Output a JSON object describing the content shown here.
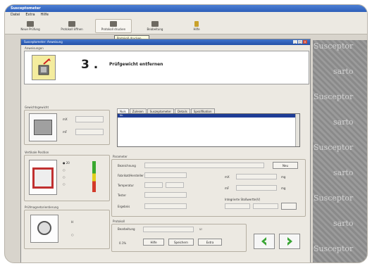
{
  "app": {
    "title": "Susceptometer"
  },
  "menu": {
    "items": [
      "Datei",
      "Extra",
      "Hilfe"
    ]
  },
  "toolbar": {
    "items": [
      {
        "label": "Neue Prüfung"
      },
      {
        "label": "Protokoll öffnen"
      },
      {
        "label": "Protokoll drucken"
      },
      {
        "label": "Beabeitung"
      },
      {
        "label": "Hilfe"
      }
    ]
  },
  "tooltip": "Protokoll drucken",
  "child": {
    "title": "Susceptometer: Anweisung"
  },
  "step": {
    "section": "Anweisungen",
    "number": "3 .",
    "text": "Prüfgewicht entfernen"
  },
  "sections": {
    "left1": "Gewichtsgewicht",
    "left2": "Vertikale Position",
    "left3": "Prüfmagnetorientierung",
    "params": "Parameter",
    "protocol": "Protokoll"
  },
  "tabs": [
    "Nuls",
    "Zulesen",
    "Suszeptometer",
    "Details",
    "Spezifikation"
  ],
  "list_items": [
    "Nr.",
    "",
    "",
    "",
    ""
  ],
  "labels": {
    "bezeichnung": "Bezeichnung",
    "fabrikat": "Fabrikat/Hersteller",
    "temperatur": "Temperatur",
    "tester": "Tester",
    "ergebnis": "Ergebnis",
    "mx": "mX",
    "mf": "mF",
    "mg1": "mg",
    "mg2": "mg",
    "integer": "Integrierte Stoßwertte(V)",
    "bearb": "Bearbeitung",
    "nr": "0.1%",
    "x_label": "X",
    "h": "H"
  },
  "buttons": {
    "neu": "Neu",
    "hilfe": "Hilfe",
    "speichern": "Speichern",
    "ok": "Ok",
    "extra": "Extra"
  },
  "watermark": [
    "Susceptor",
    "sarto",
    "Susceptor",
    "sarto",
    "Susceptor",
    "sarto",
    "Susceptor",
    "sarto",
    "Susceptor"
  ],
  "colors": {
    "accent": "#2d5fb9",
    "arrow": "#3aa534",
    "highlight": "#f4ec9e"
  }
}
